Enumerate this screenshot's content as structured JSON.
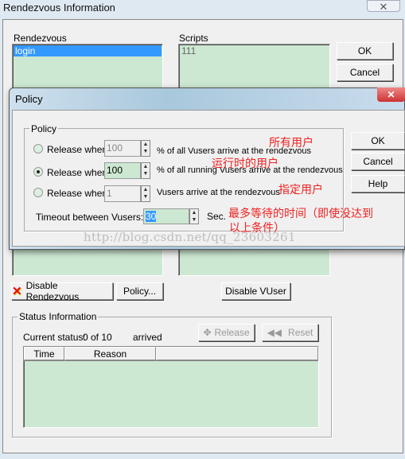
{
  "window": {
    "title": "Rendezvous Information",
    "close_icon": "close-icon"
  },
  "rendezvous": {
    "label": "Rendezvous",
    "items": [
      "login"
    ]
  },
  "scripts": {
    "label": "Scripts",
    "items": [
      "111"
    ]
  },
  "buttons": {
    "ok": "OK",
    "cancel": "Cancel",
    "disable_rendezvous": "Disable Rendezvous",
    "policy": "Policy...",
    "disable_vuser": "Disable VUser"
  },
  "status": {
    "group_label": "Status Information",
    "current_label": "Current status:",
    "current_value": "0 of 10",
    "arrived": "arrived",
    "release": "Release",
    "reset": "Reset",
    "columns": [
      "Time",
      "Reason",
      ""
    ]
  },
  "policy_dialog": {
    "title": "Policy",
    "group_label": "Policy",
    "options": [
      {
        "label": "Release when",
        "value": "100",
        "suffix": "% of all Vusers arrive at the rendezvous",
        "selected": false
      },
      {
        "label": "Release when",
        "value": "100",
        "suffix": "% of all running Vusers arrive at the rendezvous",
        "selected": true
      },
      {
        "label": "Release when",
        "value": "1",
        "suffix": "Vusers arrive at the rendezvous",
        "selected": false
      }
    ],
    "timeout_label": "Timeout between Vusers:",
    "timeout_value": "30",
    "timeout_unit": "Sec.",
    "ok": "OK",
    "cancel": "Cancel",
    "help": "Help"
  },
  "annotations": [
    "所有用户",
    "运行时的用户",
    "指定用户",
    "最多等待的时间（即使没达到",
    "以上条件）"
  ],
  "watermark": "http://blog.csdn.net/qq_23603261",
  "colors": {
    "list_bg": "#cde8d2",
    "selection": "#3399ff",
    "annotation": "#f02020"
  }
}
